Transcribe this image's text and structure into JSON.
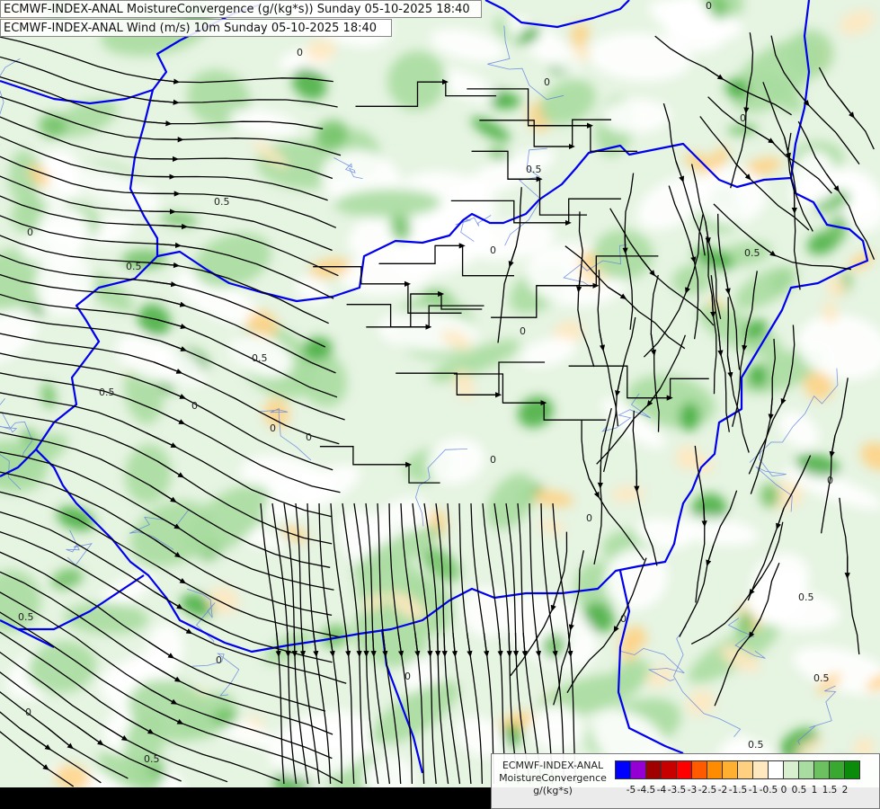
{
  "titles": {
    "line1": "ECMWF-INDEX-ANAL MoistureConvergence (g/(kg*s)) Sunday 05-10-2025 18:40",
    "line2": "ECMWF-INDEX-ANAL Wind (m/s) 10m Sunday 05-10-2025 18:40"
  },
  "legend": {
    "model": "ECMWF-INDEX-ANAL",
    "parameter": "MoistureConvergence",
    "unit": "g/(kg*s)",
    "colors": [
      "#0000ff",
      "#9400d3",
      "#a00000",
      "#c80000",
      "#ff0000",
      "#ff5a00",
      "#ff8c00",
      "#ffb030",
      "#ffd080",
      "#ffe8c0",
      "#ffffff",
      "#d8f0d0",
      "#a8dca0",
      "#6cc060",
      "#38a830",
      "#0a8c0a"
    ],
    "ticks": [
      "-5",
      "-4.5",
      "-4",
      "-3.5",
      "-3",
      "-2.5",
      "-2",
      "-1.5",
      "-1",
      "-0.5",
      "0",
      "0.5",
      "1",
      "1.5",
      "2"
    ]
  },
  "contour_labels": [
    "0",
    "0.5",
    "0",
    "0.5",
    "0",
    "0.5",
    "0",
    "0.5",
    "0",
    "0",
    "0.5",
    "0",
    "0",
    "0",
    "0",
    "0.5",
    "0",
    "0",
    "0.5",
    "0",
    "0",
    "0.5",
    "0",
    "0.5",
    "0",
    "0.5",
    "0",
    "0.5"
  ],
  "colors": {
    "border": "#0000ee",
    "streamline": "#000000",
    "convergence_green": "#a8dca0",
    "divergence_orange": "#ffd080"
  }
}
